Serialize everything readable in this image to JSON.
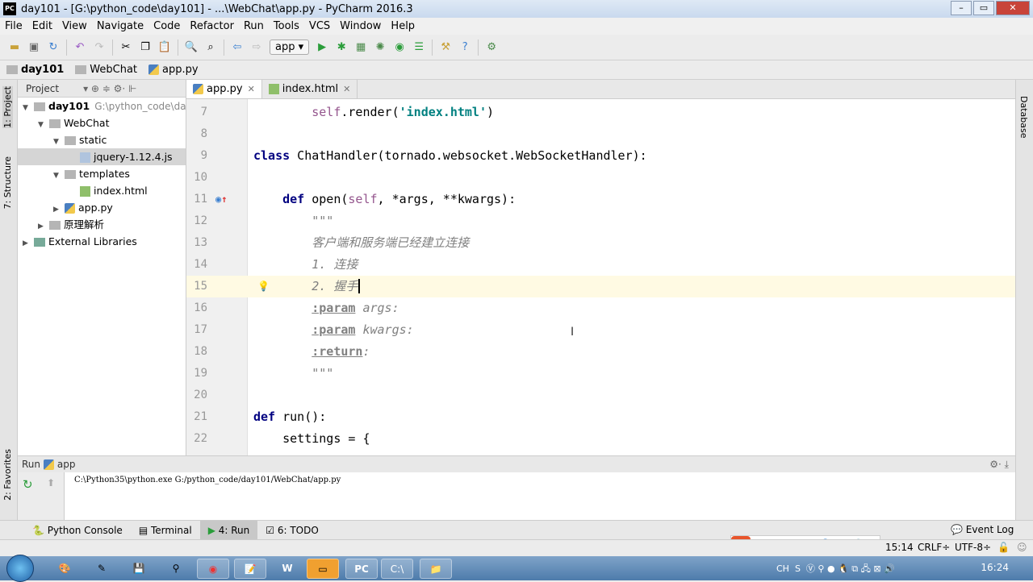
{
  "window": {
    "title": "day101 - [G:\\python_code\\day101] - ...\\WebChat\\app.py - PyCharm 2016.3",
    "logo": "PC"
  },
  "menu": [
    "File",
    "Edit",
    "View",
    "Navigate",
    "Code",
    "Refactor",
    "Run",
    "Tools",
    "VCS",
    "Window",
    "Help"
  ],
  "toolbar": {
    "run_config": "app"
  },
  "breadcrumb": [
    "day101",
    "WebChat",
    "app.py"
  ],
  "project": {
    "header": "Project",
    "tree": [
      {
        "label": "day101",
        "extra": "G:\\python_code\\day101",
        "indent": 0,
        "open": true,
        "kind": "folder",
        "bold": true
      },
      {
        "label": "WebChat",
        "indent": 1,
        "open": true,
        "kind": "folder"
      },
      {
        "label": "static",
        "indent": 2,
        "open": true,
        "kind": "folder"
      },
      {
        "label": "jquery-1.12.4.js",
        "indent": 3,
        "kind": "file",
        "selected": true
      },
      {
        "label": "templates",
        "indent": 2,
        "open": true,
        "kind": "folder"
      },
      {
        "label": "index.html",
        "indent": 3,
        "kind": "html"
      },
      {
        "label": "app.py",
        "indent": 2,
        "kind": "py",
        "closed": true
      },
      {
        "label": "原理解析",
        "indent": 1,
        "kind": "folder",
        "closed": true
      },
      {
        "label": "External Libraries",
        "indent": 0,
        "kind": "lib",
        "closed": true
      }
    ]
  },
  "side_tabs": {
    "left": [
      "1: Project",
      "7: Structure",
      "2: Favorites"
    ],
    "right": [
      "Database"
    ]
  },
  "tabs": [
    {
      "label": "app.py",
      "active": true
    },
    {
      "label": "index.html",
      "active": false
    }
  ],
  "editor": {
    "current_line": 15,
    "lines": [
      {
        "n": "7",
        "tokens": [
          [
            "pl",
            "        "
          ],
          [
            "self",
            "self"
          ],
          [
            "pl",
            ".render("
          ],
          [
            "str",
            "'index.html'"
          ],
          [
            "pl",
            ")"
          ]
        ]
      },
      {
        "n": "8",
        "tokens": []
      },
      {
        "n": "9",
        "tokens": [
          [
            "kw",
            "class"
          ],
          [
            "pl",
            " ChatHandler(tornado.websocket.WebSocketHandler):"
          ]
        ]
      },
      {
        "n": "10",
        "tokens": []
      },
      {
        "n": "11",
        "tokens": [
          [
            "pl",
            "    "
          ],
          [
            "kw",
            "def"
          ],
          [
            "pl",
            " open("
          ],
          [
            "self",
            "self"
          ],
          [
            "pl",
            ", *args, **kwargs):"
          ]
        ]
      },
      {
        "n": "12",
        "tokens": [
          [
            "doc",
            "        \"\"\""
          ]
        ]
      },
      {
        "n": "13",
        "tokens": [
          [
            "doc",
            "        客户端和服务端已经建立连接"
          ]
        ]
      },
      {
        "n": "14",
        "tokens": [
          [
            "doc",
            "        1. 连接"
          ]
        ]
      },
      {
        "n": "15",
        "tokens": [
          [
            "doc",
            "        2. 握手"
          ]
        ]
      },
      {
        "n": "16",
        "tokens": [
          [
            "pl",
            "        "
          ],
          [
            "dtag",
            ":param"
          ],
          [
            "doc",
            " args:"
          ]
        ]
      },
      {
        "n": "17",
        "tokens": [
          [
            "pl",
            "        "
          ],
          [
            "dtag",
            ":param"
          ],
          [
            "doc",
            " kwargs:"
          ]
        ]
      },
      {
        "n": "18",
        "tokens": [
          [
            "pl",
            "        "
          ],
          [
            "dtag",
            ":return"
          ],
          [
            "doc",
            ":"
          ]
        ]
      },
      {
        "n": "19",
        "tokens": [
          [
            "doc",
            "        \"\"\""
          ]
        ]
      },
      {
        "n": "20",
        "tokens": []
      },
      {
        "n": "21",
        "tokens": [
          [
            "kw",
            "def"
          ],
          [
            "pl",
            " run():"
          ]
        ]
      },
      {
        "n": "22",
        "tokens": [
          [
            "pl",
            "    settings = {"
          ]
        ]
      }
    ]
  },
  "run": {
    "label": "Run",
    "config": "app",
    "output": "C:\\Python35\\python.exe G:/python_code/day101/WebChat/app.py"
  },
  "tool_tabs": [
    {
      "label": "Python Console"
    },
    {
      "label": "Terminal"
    },
    {
      "label": "4: Run",
      "active": true
    },
    {
      "label": "6: TODO"
    }
  ],
  "status": {
    "position": "15:14",
    "line_sep": "CRLF÷",
    "encoding": "UTF-8÷",
    "event_log": "Event Log"
  },
  "ime": {
    "logo": "S",
    "mode": "中"
  },
  "taskbar": {
    "lang": "CH",
    "clock": "16:24"
  },
  "colors": {
    "keyword": "#000080",
    "string": "#008080",
    "docstring": "#808080",
    "self": "#94558d",
    "current_line": "#fffae3"
  }
}
